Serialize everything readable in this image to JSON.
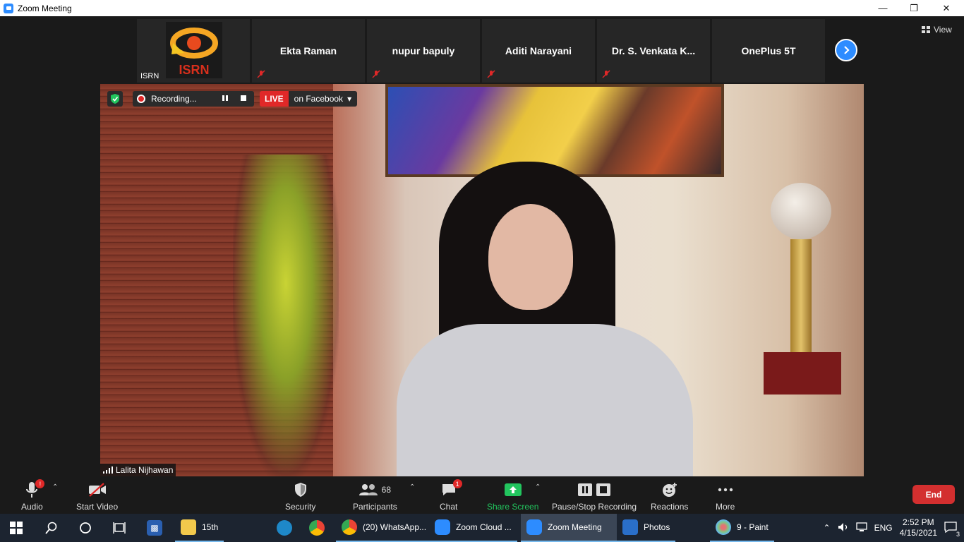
{
  "window": {
    "title": "Zoom Meeting"
  },
  "thumbnails": [
    {
      "name": "ISRN",
      "logo_text": "ISRN"
    },
    {
      "name": "Ekta Raman"
    },
    {
      "name": "nupur bapuly"
    },
    {
      "name": "Aditi Narayani"
    },
    {
      "name": "Dr. S. Venkata K..."
    },
    {
      "name": "OnePlus 5T"
    }
  ],
  "view_label": "View",
  "recording": {
    "status": "Recording...",
    "live_badge": "LIVE",
    "live_target": "on Facebook"
  },
  "speaker": {
    "name": "Lalita Nijhawan"
  },
  "toolbar": {
    "audio": "Audio",
    "video": "Start Video",
    "security": "Security",
    "participants": "Participants",
    "participants_count": "68",
    "chat": "Chat",
    "chat_badge": "1",
    "audio_badge": "!",
    "share": "Share Screen",
    "recording": "Pause/Stop Recording",
    "reactions": "Reactions",
    "more": "More",
    "end": "End"
  },
  "taskbar": {
    "items": [
      {
        "label": "15th"
      },
      {
        "label": "(20) WhatsApp..."
      },
      {
        "label": "Zoom Cloud ..."
      },
      {
        "label": "Zoom Meeting"
      },
      {
        "label": "Photos"
      },
      {
        "label": "9 - Paint"
      }
    ],
    "language": "ENG",
    "time": "2:52 PM",
    "date": "4/15/2021",
    "notifications": "3"
  },
  "colors": {
    "accent": "#2d8cff",
    "live": "#e02828",
    "share": "#22c55e",
    "end": "#d32f2f"
  }
}
